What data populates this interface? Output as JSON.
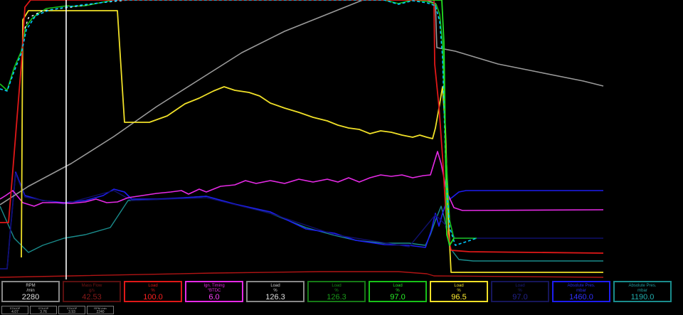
{
  "cursor": {
    "time_index": 93
  },
  "series": [
    {
      "id": "absolute-pres-1190",
      "color": "#1a8c8c",
      "width": 1.4,
      "points": [
        [
          0,
          290
        ],
        [
          20,
          335
        ],
        [
          40,
          355
        ],
        [
          60,
          345
        ],
        [
          90,
          335
        ],
        [
          120,
          330
        ],
        [
          155,
          320
        ],
        [
          180,
          282
        ],
        [
          230,
          280
        ],
        [
          290,
          276
        ],
        [
          330,
          287
        ],
        [
          380,
          300
        ],
        [
          430,
          320
        ],
        [
          470,
          331
        ],
        [
          500,
          338
        ],
        [
          540,
          342
        ],
        [
          575,
          342
        ],
        [
          598,
          345
        ],
        [
          605,
          330
        ],
        [
          612,
          310
        ],
        [
          620,
          290
        ],
        [
          625,
          308
        ],
        [
          632,
          348
        ],
        [
          645,
          365
        ],
        [
          665,
          367
        ],
        [
          760,
          367
        ],
        [
          848,
          367
        ]
      ]
    },
    {
      "id": "absolute-pres-1460",
      "color": "#1e1ef0",
      "width": 1.6,
      "points": [
        [
          0,
          378
        ],
        [
          10,
          378
        ],
        [
          15,
          320
        ],
        [
          22,
          242
        ],
        [
          35,
          275
        ],
        [
          60,
          282
        ],
        [
          90,
          285
        ],
        [
          120,
          282
        ],
        [
          145,
          275
        ],
        [
          160,
          266
        ],
        [
          175,
          270
        ],
        [
          185,
          280
        ],
        [
          220,
          280
        ],
        [
          260,
          278
        ],
        [
          290,
          276
        ],
        [
          330,
          287
        ],
        [
          380,
          298
        ],
        [
          430,
          322
        ],
        [
          470,
          328
        ],
        [
          500,
          338
        ],
        [
          540,
          344
        ],
        [
          575,
          345
        ],
        [
          598,
          348
        ],
        [
          606,
          325
        ],
        [
          612,
          300
        ],
        [
          617,
          318
        ],
        [
          622,
          300
        ],
        [
          628,
          283
        ],
        [
          635,
          278
        ],
        [
          645,
          270
        ],
        [
          655,
          268
        ],
        [
          700,
          268
        ],
        [
          848,
          268
        ]
      ]
    },
    {
      "id": "load-dark-blue",
      "color": "#10106a",
      "width": 1.4,
      "points": [
        [
          0,
          378
        ],
        [
          10,
          378
        ],
        [
          15,
          322
        ],
        [
          22,
          244
        ],
        [
          35,
          277
        ],
        [
          90,
          287
        ],
        [
          160,
          268
        ],
        [
          185,
          282
        ],
        [
          290,
          278
        ],
        [
          380,
          300
        ],
        [
          470,
          330
        ],
        [
          575,
          347
        ],
        [
          612,
          302
        ],
        [
          630,
          320
        ],
        [
          640,
          335
        ],
        [
          670,
          335
        ],
        [
          848,
          335
        ]
      ]
    },
    {
      "id": "ign-timing",
      "color": "#e62ae6",
      "width": 1.6,
      "points": [
        [
          0,
          280
        ],
        [
          8,
          275
        ],
        [
          18,
          268
        ],
        [
          32,
          285
        ],
        [
          48,
          290
        ],
        [
          60,
          285
        ],
        [
          80,
          285
        ],
        [
          100,
          286
        ],
        [
          120,
          284
        ],
        [
          135,
          280
        ],
        [
          150,
          285
        ],
        [
          165,
          284
        ],
        [
          180,
          278
        ],
        [
          200,
          275
        ],
        [
          220,
          272
        ],
        [
          240,
          270
        ],
        [
          255,
          268
        ],
        [
          265,
          273
        ],
        [
          280,
          266
        ],
        [
          290,
          270
        ],
        [
          310,
          262
        ],
        [
          330,
          260
        ],
        [
          345,
          254
        ],
        [
          360,
          258
        ],
        [
          380,
          254
        ],
        [
          400,
          258
        ],
        [
          420,
          252
        ],
        [
          440,
          256
        ],
        [
          460,
          252
        ],
        [
          475,
          256
        ],
        [
          490,
          250
        ],
        [
          505,
          256
        ],
        [
          520,
          250
        ],
        [
          535,
          246
        ],
        [
          550,
          248
        ],
        [
          565,
          246
        ],
        [
          580,
          250
        ],
        [
          595,
          247
        ],
        [
          605,
          246
        ],
        [
          615,
          213
        ],
        [
          620,
          230
        ],
        [
          628,
          270
        ],
        [
          638,
          292
        ],
        [
          650,
          296
        ],
        [
          848,
          295
        ]
      ]
    },
    {
      "id": "rpm",
      "color": "#9a9a9a",
      "width": 1.6,
      "points": [
        [
          0,
          288
        ],
        [
          40,
          262
        ],
        [
          100,
          230
        ],
        [
          160,
          192
        ],
        [
          220,
          150
        ],
        [
          280,
          112
        ],
        [
          340,
          74
        ],
        [
          400,
          44
        ],
        [
          460,
          20
        ],
        [
          510,
          0
        ],
        [
          560,
          0
        ],
        [
          600,
          0
        ],
        [
          612,
          5
        ],
        [
          614,
          67
        ],
        [
          640,
          72
        ],
        [
          660,
          78
        ],
        [
          700,
          90
        ],
        [
          760,
          102
        ],
        [
          820,
          114
        ],
        [
          848,
          121
        ]
      ]
    },
    {
      "id": "load-yellow",
      "color": "#f0e028",
      "width": 1.8,
      "points": [
        [
          30,
          362
        ],
        [
          32,
          28
        ],
        [
          40,
          15
        ],
        [
          165,
          15
        ],
        [
          175,
          172
        ],
        [
          210,
          172
        ],
        [
          235,
          163
        ],
        [
          260,
          146
        ],
        [
          280,
          138
        ],
        [
          300,
          128
        ],
        [
          315,
          122
        ],
        [
          330,
          127
        ],
        [
          350,
          130
        ],
        [
          365,
          135
        ],
        [
          380,
          145
        ],
        [
          400,
          152
        ],
        [
          420,
          158
        ],
        [
          440,
          165
        ],
        [
          460,
          170
        ],
        [
          475,
          176
        ],
        [
          490,
          180
        ],
        [
          505,
          182
        ],
        [
          520,
          188
        ],
        [
          535,
          184
        ],
        [
          550,
          186
        ],
        [
          565,
          190
        ],
        [
          580,
          193
        ],
        [
          590,
          190
        ],
        [
          600,
          193
        ],
        [
          608,
          195
        ],
        [
          612,
          180
        ],
        [
          617,
          152
        ],
        [
          622,
          122
        ],
        [
          626,
          180
        ],
        [
          630,
          305
        ],
        [
          634,
          383
        ],
        [
          848,
          383
        ]
      ]
    },
    {
      "id": "load-green",
      "color": "#18c218",
      "width": 1.6,
      "points": [
        [
          0,
          118
        ],
        [
          10,
          127
        ],
        [
          20,
          95
        ],
        [
          30,
          72
        ],
        [
          36,
          38
        ],
        [
          45,
          26
        ],
        [
          55,
          18
        ],
        [
          65,
          12
        ],
        [
          80,
          10
        ],
        [
          95,
          8
        ],
        [
          100,
          9
        ],
        [
          120,
          8
        ],
        [
          140,
          4
        ],
        [
          160,
          0
        ],
        [
          540,
          0
        ],
        [
          560,
          5
        ],
        [
          580,
          0
        ],
        [
          600,
          2
        ],
        [
          613,
          6
        ],
        [
          618,
          20
        ],
        [
          622,
          60
        ],
        [
          626,
          200
        ],
        [
          632,
          310
        ],
        [
          638,
          335
        ],
        [
          670,
          335
        ]
      ]
    },
    {
      "id": "load-white",
      "color": "#ffffff",
      "width": 1.4,
      "dash": "3,4",
      "points": [
        [
          35,
          40
        ],
        [
          40,
          25
        ],
        [
          60,
          15
        ],
        [
          100,
          10
        ],
        [
          140,
          4
        ],
        [
          180,
          0
        ]
      ]
    },
    {
      "id": "load-100",
      "color": "#e01818",
      "width": 1.8,
      "points": [
        [
          0,
          313
        ],
        [
          12,
          313
        ],
        [
          18,
          240
        ],
        [
          30,
          90
        ],
        [
          35,
          10
        ],
        [
          43,
          0
        ],
        [
          610,
          0
        ],
        [
          611,
          90
        ],
        [
          617,
          150
        ],
        [
          622,
          220
        ],
        [
          628,
          320
        ],
        [
          634,
          352
        ],
        [
          660,
          354
        ],
        [
          848,
          356
        ]
      ]
    },
    {
      "id": "load-126",
      "color": "#b01414",
      "width": 1.4,
      "points": [
        [
          0,
          390
        ],
        [
          100,
          388
        ],
        [
          300,
          384
        ],
        [
          450,
          382
        ],
        [
          560,
          382
        ],
        [
          600,
          385
        ],
        [
          610,
          388
        ],
        [
          848,
          390
        ]
      ]
    },
    {
      "id": "mass-flow",
      "color": "#00c8ff",
      "width": 1.6,
      "dash": "4,3",
      "points": [
        [
          0,
          125
        ],
        [
          10,
          128
        ],
        [
          20,
          100
        ],
        [
          30,
          75
        ],
        [
          37,
          42
        ],
        [
          50,
          22
        ],
        [
          70,
          14
        ],
        [
          100,
          9
        ],
        [
          140,
          4
        ],
        [
          170,
          0
        ],
        [
          540,
          0
        ],
        [
          560,
          6
        ],
        [
          580,
          1
        ],
        [
          600,
          4
        ],
        [
          612,
          8
        ],
        [
          618,
          30
        ],
        [
          622,
          80
        ],
        [
          627,
          250
        ],
        [
          632,
          320
        ],
        [
          640,
          345
        ],
        [
          670,
          335
        ]
      ]
    },
    {
      "id": "load-97",
      "color": "#22e022",
      "width": 1.8,
      "points": [
        [
          605,
          0
        ],
        [
          618,
          0
        ],
        [
          621,
          0
        ],
        [
          624,
          60
        ],
        [
          626,
          200
        ],
        [
          628,
          330
        ],
        [
          632,
          345
        ],
        [
          638,
          335
        ]
      ]
    }
  ],
  "gauges": [
    {
      "label": "RPM",
      "unit": "/min",
      "value": "2280",
      "border": "#888888",
      "text": "#cfcfcf",
      "value_color": "#e0e0e0"
    },
    {
      "label": "Mass Flow",
      "unit": "g/s",
      "value": "42.53",
      "border": "#5a1010",
      "text": "#7a1616",
      "value_color": "#8a1a1a"
    },
    {
      "label": "Load",
      "unit": "%",
      "value": "100.0",
      "border": "#e01818",
      "text": "#e01818",
      "value_color": "#ff2020"
    },
    {
      "label": "Ign. Timing",
      "unit": "°BTDC",
      "value": "6.0",
      "border": "#e62ae6",
      "text": "#e62ae6",
      "value_color": "#ff40ff"
    },
    {
      "label": "Load",
      "unit": "%",
      "value": "126.3",
      "border": "#888888",
      "text": "#cfcfcf",
      "value_color": "#e0e0e0"
    },
    {
      "label": "Load",
      "unit": "%",
      "value": "126.3",
      "border": "#167a16",
      "text": "#169016",
      "value_color": "#1a9a1a"
    },
    {
      "label": "Load",
      "unit": "%",
      "value": "97.0",
      "border": "#18c218",
      "text": "#20e020",
      "value_color": "#28f028"
    },
    {
      "label": "Load",
      "unit": "%",
      "value": "96.5",
      "border": "#f0e028",
      "text": "#f0e028",
      "value_color": "#ffee30"
    },
    {
      "label": "Load",
      "unit": "%",
      "value": "97.0",
      "border": "#16165a",
      "text": "#1c1c80",
      "value_color": "#22228c"
    },
    {
      "label": "Absolute Pres.",
      "unit": "mbar",
      "value": "1460.0",
      "border": "#1e1ef0",
      "text": "#2a2af0",
      "value_color": "#3030ff"
    },
    {
      "label": "Absolute Pres.",
      "unit": "mbar",
      "value": "1190.0",
      "border": "#1a8c8c",
      "text": "#1fa0a0",
      "value_color": "#22b0b0"
    }
  ],
  "mini_readouts": [
    {
      "label": "STA10P",
      "value": "4.07"
    },
    {
      "label": "STA10P",
      "value": "3.76"
    },
    {
      "label": "STA10P",
      "value": "3.93"
    },
    {
      "label": "RPM /min",
      "value": "2240"
    }
  ]
}
